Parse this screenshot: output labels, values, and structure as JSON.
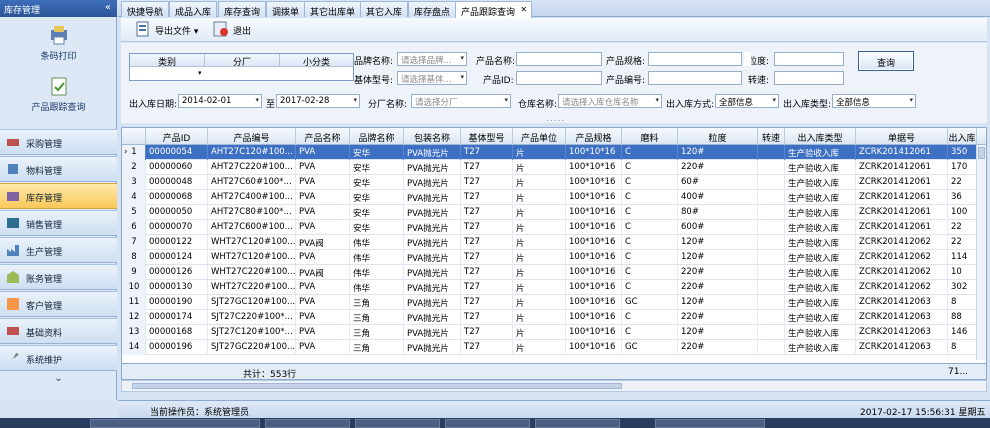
{
  "sidebar": {
    "title": "库存管理",
    "collapse": "«",
    "tools": [
      {
        "label": "条码打印"
      },
      {
        "label": "产品跟踪查询"
      }
    ],
    "nav": [
      {
        "label": "采购管理"
      },
      {
        "label": "物料管理"
      },
      {
        "label": "库存管理"
      },
      {
        "label": "销售管理"
      },
      {
        "label": "生产管理"
      },
      {
        "label": "账务管理"
      },
      {
        "label": "客户管理"
      },
      {
        "label": "基础资料"
      },
      {
        "label": "系统维护"
      }
    ],
    "bottom": "⌄"
  },
  "tabs": [
    "快捷导航",
    "成品入库",
    "库存查询",
    "调拨单",
    "其它出库单",
    "其它入库",
    "库存盘点",
    "产品跟踪查询"
  ],
  "tab_close": "✕",
  "toolbar": {
    "export": "导出文件",
    "export_arrow": "▾",
    "exit": "退出"
  },
  "filter": {
    "category_headers": [
      "类别",
      "分厂",
      "小分类"
    ],
    "brand_label": "品牌名称:",
    "brand_ph": "请选择品牌...",
    "pname_label": "产品名称:",
    "spec_label": "产品规格:",
    "grain_label": "粒度:",
    "base_label": "基体型号:",
    "base_ph": "请选择基体...",
    "pid_label": "产品ID:",
    "pcode_label": "产品编号:",
    "speed_label": "转速:",
    "query": "查询",
    "date_label": "出入库日期:",
    "date_from": "2014-02-01",
    "to": "至",
    "date_to": "2017-02-28",
    "factory_label": "分厂名称:",
    "factory_ph": "请选择分厂",
    "wh_label": "仓库名称:",
    "wh_ph": "请选择入库仓库名称",
    "io_mode_label": "出入库方式:",
    "io_mode": "全部信息",
    "io_type_label": "出入库类型:",
    "io_type": "全部信息",
    "dropdown": "▾",
    "splitter": "....."
  },
  "grid": {
    "headers": [
      "产品ID",
      "产品编号",
      "产品名称",
      "品牌名称",
      "包装名称",
      "基体型号",
      "产品单位",
      "产品规格",
      "磨料",
      "粒度",
      "转速",
      "出入库类型",
      "单据号",
      "出入库"
    ],
    "rows": [
      {
        "n": "1",
        "id": "00000054",
        "code": "AHT27C120#100...",
        "name": "PVA",
        "brand": "安华",
        "pack": "PVA抛光片",
        "base": "T27",
        "unit": "片",
        "spec": "100*10*16",
        "abr": "C",
        "grain": "120#",
        "speed": "",
        "type": "生产验收入库",
        "doc": "ZCRK201412061",
        "qty": "350"
      },
      {
        "n": "2",
        "id": "00000060",
        "code": "AHT27C220#100...",
        "name": "PVA",
        "brand": "安华",
        "pack": "PVA抛光片",
        "base": "T27",
        "unit": "片",
        "spec": "100*10*16",
        "abr": "C",
        "grain": "220#",
        "speed": "",
        "type": "生产验收入库",
        "doc": "ZCRK201412061",
        "qty": "170"
      },
      {
        "n": "3",
        "id": "00000048",
        "code": "AHT27C60#100*...",
        "name": "PVA",
        "brand": "安华",
        "pack": "PVA抛光片",
        "base": "T27",
        "unit": "片",
        "spec": "100*10*16",
        "abr": "C",
        "grain": "60#",
        "speed": "",
        "type": "生产验收入库",
        "doc": "ZCRK201412061",
        "qty": "22"
      },
      {
        "n": "4",
        "id": "00000068",
        "code": "AHT27C400#100...",
        "name": "PVA",
        "brand": "安华",
        "pack": "PVA抛光片",
        "base": "T27",
        "unit": "片",
        "spec": "100*10*16",
        "abr": "C",
        "grain": "400#",
        "speed": "",
        "type": "生产验收入库",
        "doc": "ZCRK201412061",
        "qty": "36"
      },
      {
        "n": "5",
        "id": "00000050",
        "code": "AHT27C80#100*...",
        "name": "PVA",
        "brand": "安华",
        "pack": "PVA抛光片",
        "base": "T27",
        "unit": "片",
        "spec": "100*10*16",
        "abr": "C",
        "grain": "80#",
        "speed": "",
        "type": "生产验收入库",
        "doc": "ZCRK201412061",
        "qty": "100"
      },
      {
        "n": "6",
        "id": "00000070",
        "code": "AHT27C600#100...",
        "name": "PVA",
        "brand": "安华",
        "pack": "PVA抛光片",
        "base": "T27",
        "unit": "片",
        "spec": "100*10*16",
        "abr": "C",
        "grain": "600#",
        "speed": "",
        "type": "生产验收入库",
        "doc": "ZCRK201412061",
        "qty": "22"
      },
      {
        "n": "7",
        "id": "00000122",
        "code": "WHT27C120#100...",
        "name": "PVA阀",
        "brand": "伟华",
        "pack": "PVA抛光片",
        "base": "T27",
        "unit": "片",
        "spec": "100*10*16",
        "abr": "C",
        "grain": "120#",
        "speed": "",
        "type": "生产验收入库",
        "doc": "ZCRK201412062",
        "qty": "22"
      },
      {
        "n": "8",
        "id": "00000124",
        "code": "WHT27C120#100...",
        "name": "PVA",
        "brand": "伟华",
        "pack": "PVA抛光片",
        "base": "T27",
        "unit": "片",
        "spec": "100*10*16",
        "abr": "C",
        "grain": "120#",
        "speed": "",
        "type": "生产验收入库",
        "doc": "ZCRK201412062",
        "qty": "114"
      },
      {
        "n": "9",
        "id": "00000126",
        "code": "WHT27C220#100...",
        "name": "PVA阀",
        "brand": "伟华",
        "pack": "PVA抛光片",
        "base": "T27",
        "unit": "片",
        "spec": "100*10*16",
        "abr": "C",
        "grain": "220#",
        "speed": "",
        "type": "生产验收入库",
        "doc": "ZCRK201412062",
        "qty": "10"
      },
      {
        "n": "10",
        "id": "00000130",
        "code": "WHT27C220#100...",
        "name": "PVA",
        "brand": "伟华",
        "pack": "PVA抛光片",
        "base": "T27",
        "unit": "片",
        "spec": "100*10*16",
        "abr": "C",
        "grain": "220#",
        "speed": "",
        "type": "生产验收入库",
        "doc": "ZCRK201412062",
        "qty": "302"
      },
      {
        "n": "11",
        "id": "00000190",
        "code": "SJT27GC120#100...",
        "name": "PVA",
        "brand": "三角",
        "pack": "PVA抛光片",
        "base": "T27",
        "unit": "片",
        "spec": "100*10*16",
        "abr": "GC",
        "grain": "120#",
        "speed": "",
        "type": "生产验收入库",
        "doc": "ZCRK201412063",
        "qty": "8"
      },
      {
        "n": "12",
        "id": "00000174",
        "code": "SJT27C220#100*...",
        "name": "PVA",
        "brand": "三角",
        "pack": "PVA抛光片",
        "base": "T27",
        "unit": "片",
        "spec": "100*10*16",
        "abr": "C",
        "grain": "220#",
        "speed": "",
        "type": "生产验收入库",
        "doc": "ZCRK201412063",
        "qty": "88"
      },
      {
        "n": "13",
        "id": "00000168",
        "code": "SJT27C120#100*...",
        "name": "PVA",
        "brand": "三角",
        "pack": "PVA抛光片",
        "base": "T27",
        "unit": "片",
        "spec": "100*10*16",
        "abr": "C",
        "grain": "120#",
        "speed": "",
        "type": "生产验收入库",
        "doc": "ZCRK201412063",
        "qty": "146"
      },
      {
        "n": "14",
        "id": "00000196",
        "code": "SJT27GC220#100...",
        "name": "PVA",
        "brand": "三角",
        "pack": "PVA抛光片",
        "base": "T27",
        "unit": "片",
        "spec": "100*10*16",
        "abr": "GC",
        "grain": "220#",
        "speed": "",
        "type": "生产验收入库",
        "doc": "ZCRK201412063",
        "qty": "8"
      }
    ],
    "selected_marker": "›",
    "footer_total": "共计：553行",
    "footer_right": "71..."
  },
  "status": {
    "operator": "当前操作员：系统管理员",
    "datetime": "2017-02-17 15:56:31 星期五"
  },
  "colors": {
    "accent": "#3d6fc2",
    "active_nav": "#f9c85a",
    "frame": "#8ba9cf"
  }
}
